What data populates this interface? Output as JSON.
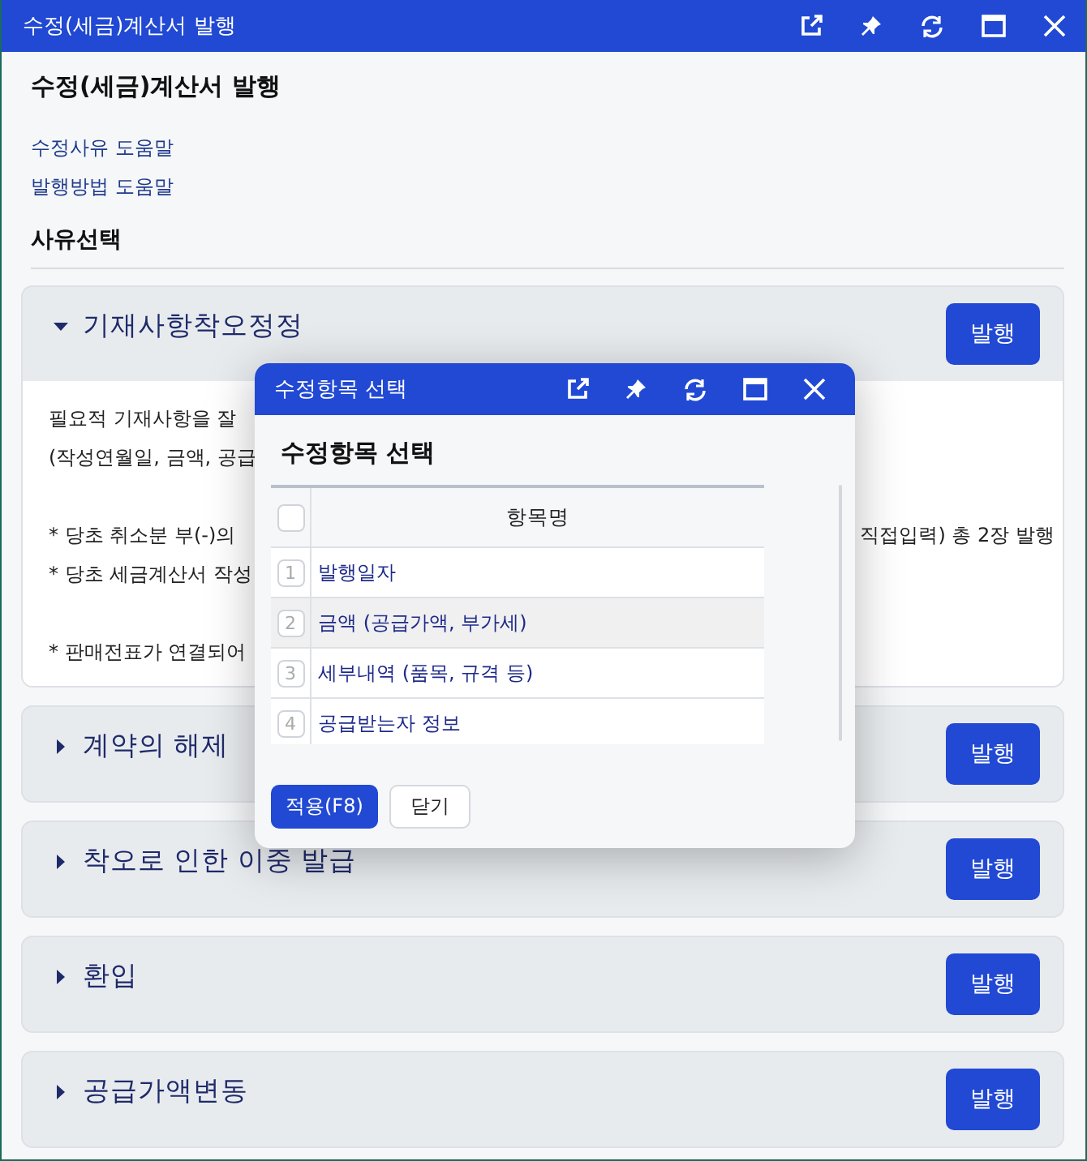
{
  "window": {
    "title": "수정(세금)계산서 발행"
  },
  "page": {
    "heading": "수정(세금)계산서 발행",
    "links": [
      "수정사유 도움말",
      "발행방법 도움말"
    ],
    "section_label": "사유선택"
  },
  "reasons": [
    {
      "title": "기재사항착오정정",
      "expanded": true,
      "button": "발행",
      "paragraphs": [
        {
          "lines": [
            {
              "text": "필요적 기재사항을 잘"
            },
            {
              "text": "(작성연월일, 금액, 공급"
            }
          ]
        },
        {
          "lines": [
            {
              "text": "* 당초 취소분 부(-)의",
              "text_right": "직접입력) 총 2장 발행"
            },
            {
              "text": "* 당초 세금계산서 작성"
            }
          ]
        },
        {
          "lines": [
            {
              "text": "* 판매전표가 연결되어"
            }
          ]
        }
      ]
    },
    {
      "title": "계약의 해제",
      "expanded": false,
      "button": "발행"
    },
    {
      "title": "착오로 인한 이중 발급",
      "expanded": false,
      "button": "발행"
    },
    {
      "title": "환입",
      "expanded": false,
      "button": "발행"
    },
    {
      "title": "공급가액변동",
      "expanded": false,
      "button": "발행"
    }
  ],
  "dialog": {
    "title": "수정항목 선택",
    "heading": "수정항목 선택",
    "column": "항목명",
    "all_checked": false,
    "rows": [
      {
        "number": "1",
        "label": "발행일자",
        "selected": false
      },
      {
        "number": "2",
        "label": "금액 (공급가액, 부가세)",
        "selected": true
      },
      {
        "number": "3",
        "label": "세부내역 (품목, 규격 등)",
        "selected": false
      },
      {
        "number": "4",
        "label": "공급받는자 정보",
        "selected": false
      }
    ],
    "buttons": [
      {
        "label": "적용(F8)",
        "kind": "primary"
      },
      {
        "label": "닫기",
        "kind": "secondary"
      }
    ]
  }
}
